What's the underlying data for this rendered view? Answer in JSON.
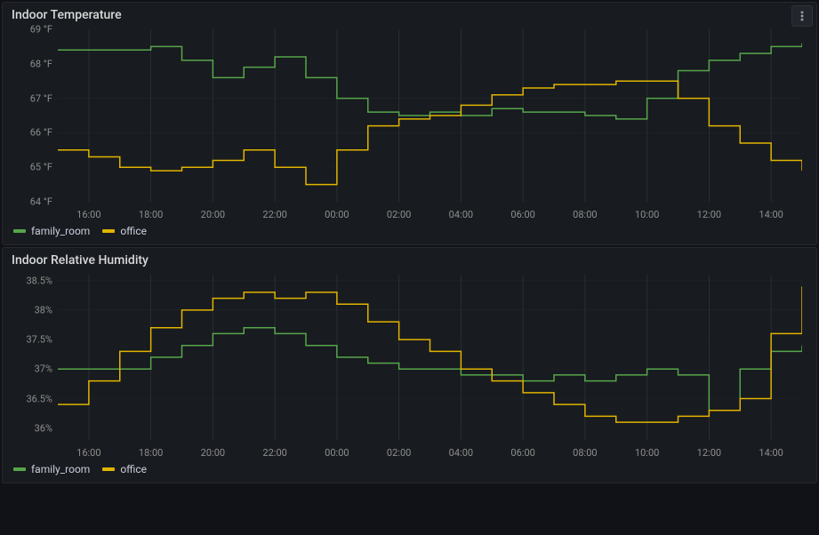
{
  "panels": {
    "temperature": {
      "title": "Indoor Temperature",
      "legend": {
        "family_room": "family_room",
        "office": "office"
      },
      "y_ticks": [
        "64 °F",
        "65 °F",
        "66 °F",
        "67 °F",
        "68 °F",
        "69 °F"
      ],
      "x_ticks": [
        "16:00",
        "18:00",
        "20:00",
        "22:00",
        "00:00",
        "02:00",
        "04:00",
        "06:00",
        "08:00",
        "10:00",
        "12:00",
        "14:00"
      ]
    },
    "humidity": {
      "title": "Indoor Relative Humidity",
      "legend": {
        "family_room": "family_room",
        "office": "office"
      },
      "y_ticks": [
        "36%",
        "36.5%",
        "37%",
        "37.5%",
        "38%",
        "38.5%"
      ],
      "x_ticks": [
        "16:00",
        "18:00",
        "20:00",
        "22:00",
        "00:00",
        "02:00",
        "04:00",
        "06:00",
        "08:00",
        "10:00",
        "12:00",
        "14:00"
      ]
    }
  },
  "colors": {
    "family_room": "#56a64b",
    "office": "#e0b400",
    "grid": "#2c3235",
    "panel_bg": "#181b1f"
  },
  "chart_data": [
    {
      "type": "line",
      "title": "Indoor Temperature",
      "xlabel": "",
      "ylabel": "",
      "ylim": [
        64,
        69
      ],
      "x": [
        "15:00",
        "16:00",
        "17:00",
        "18:00",
        "19:00",
        "20:00",
        "21:00",
        "22:00",
        "23:00",
        "00:00",
        "01:00",
        "02:00",
        "03:00",
        "04:00",
        "05:00",
        "06:00",
        "07:00",
        "08:00",
        "09:00",
        "10:00",
        "11:00",
        "12:00",
        "13:00",
        "14:00",
        "15:00"
      ],
      "series": [
        {
          "name": "family_room",
          "values": [
            68.4,
            68.4,
            68.4,
            68.5,
            68.1,
            67.6,
            67.9,
            68.2,
            67.6,
            67.0,
            66.6,
            66.5,
            66.6,
            66.5,
            66.7,
            66.6,
            66.6,
            66.5,
            66.4,
            67.0,
            67.8,
            68.1,
            68.3,
            68.5,
            68.6
          ]
        },
        {
          "name": "office",
          "values": [
            65.5,
            65.3,
            65.0,
            64.9,
            65.0,
            65.2,
            65.5,
            65.0,
            64.5,
            65.5,
            66.2,
            66.4,
            66.5,
            66.8,
            67.1,
            67.3,
            67.4,
            67.4,
            67.5,
            67.5,
            67.0,
            66.2,
            65.7,
            65.2,
            64.9
          ]
        }
      ]
    },
    {
      "type": "line",
      "title": "Indoor Relative Humidity",
      "xlabel": "",
      "ylabel": "",
      "ylim": [
        35.8,
        38.6
      ],
      "x": [
        "15:00",
        "16:00",
        "17:00",
        "18:00",
        "19:00",
        "20:00",
        "21:00",
        "22:00",
        "23:00",
        "00:00",
        "01:00",
        "02:00",
        "03:00",
        "04:00",
        "05:00",
        "06:00",
        "07:00",
        "08:00",
        "09:00",
        "10:00",
        "11:00",
        "12:00",
        "13:00",
        "14:00",
        "15:00"
      ],
      "series": [
        {
          "name": "family_room",
          "values": [
            37.0,
            37.0,
            37.0,
            37.2,
            37.4,
            37.6,
            37.7,
            37.6,
            37.4,
            37.2,
            37.1,
            37.0,
            37.0,
            36.9,
            36.9,
            36.8,
            36.9,
            36.8,
            36.9,
            37.0,
            36.9,
            36.3,
            37.0,
            37.3,
            37.4
          ]
        },
        {
          "name": "office",
          "values": [
            36.4,
            36.8,
            37.3,
            37.7,
            38.0,
            38.2,
            38.3,
            38.2,
            38.3,
            38.1,
            37.8,
            37.5,
            37.3,
            37.0,
            36.8,
            36.6,
            36.4,
            36.2,
            36.1,
            36.1,
            36.2,
            36.3,
            36.5,
            37.6,
            38.4
          ]
        }
      ]
    }
  ]
}
